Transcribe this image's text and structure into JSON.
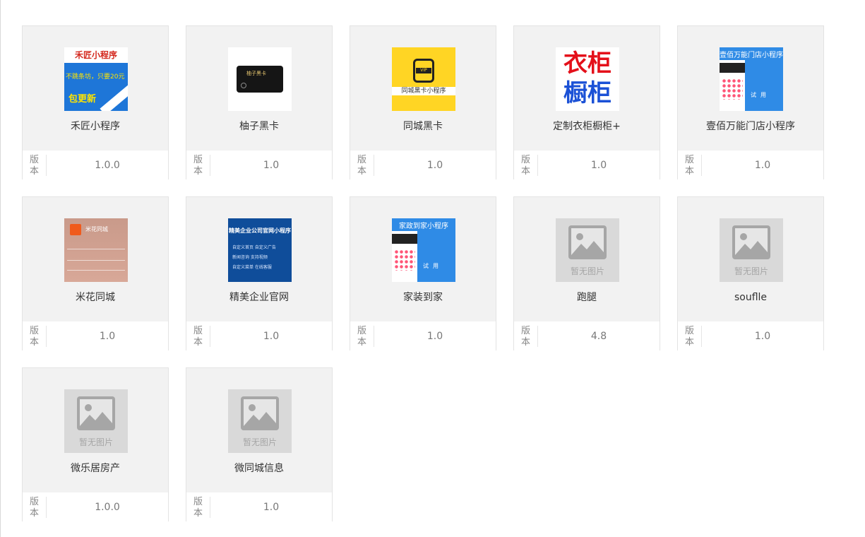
{
  "version_label": "版本",
  "placeholder_text": "暂无图片",
  "apps": [
    {
      "name": "禾匠小程序",
      "version": "1.0.0",
      "thumb": "hejiang",
      "thumb_text": {
        "banner": "禾匠小程序",
        "line1": "不跳条坊，只要20元",
        "line2": "包更新"
      }
    },
    {
      "name": "柚子黑卡",
      "version": "1.0",
      "thumb": "youzi",
      "thumb_text": {
        "logo": "柚子黑卡"
      }
    },
    {
      "name": "同城黑卡",
      "version": "1.0",
      "thumb": "tongcheng",
      "thumb_text": {
        "badge": "VIP",
        "caption": "同城黑卡小程序"
      }
    },
    {
      "name": "定制衣柜橱柜+",
      "version": "1.0",
      "thumb": "yigui",
      "thumb_text": {
        "line1": "衣柜",
        "line2": "橱柜"
      }
    },
    {
      "name": "壹佰万能门店小程序",
      "version": "1.0",
      "thumb": "yibai",
      "thumb_text": {
        "header": "壹佰万能门店小程序",
        "buttons": "试用"
      }
    },
    {
      "name": "米花同城",
      "version": "1.0",
      "thumb": "mihua",
      "thumb_text": {
        "title": "米花同城"
      }
    },
    {
      "name": "精美企业官网",
      "version": "1.0",
      "thumb": "jingmei",
      "thumb_text": {
        "header": "精美企业公司官网小程序",
        "row1": "自定义首页  自定义广告",
        "row2": "新闻咨询  支持视频",
        "row3": "自定义菜单  在线客服"
      }
    },
    {
      "name": "家装到家",
      "version": "1.0",
      "thumb": "jiazhuang",
      "thumb_text": {
        "header": "家政到家小程序",
        "buttons": "试用"
      }
    },
    {
      "name": "跑腿",
      "version": "4.8",
      "thumb": "placeholder"
    },
    {
      "name": "souflle",
      "version": "1.0",
      "thumb": "placeholder"
    },
    {
      "name": "微乐居房产",
      "version": "1.0.0",
      "thumb": "placeholder"
    },
    {
      "name": "微同城信息",
      "version": "1.0",
      "thumb": "placeholder"
    }
  ],
  "colors": {
    "card_top": "#f2f2f2",
    "border": "#e3e3e3",
    "text": "#333333",
    "muted": "#888888"
  }
}
